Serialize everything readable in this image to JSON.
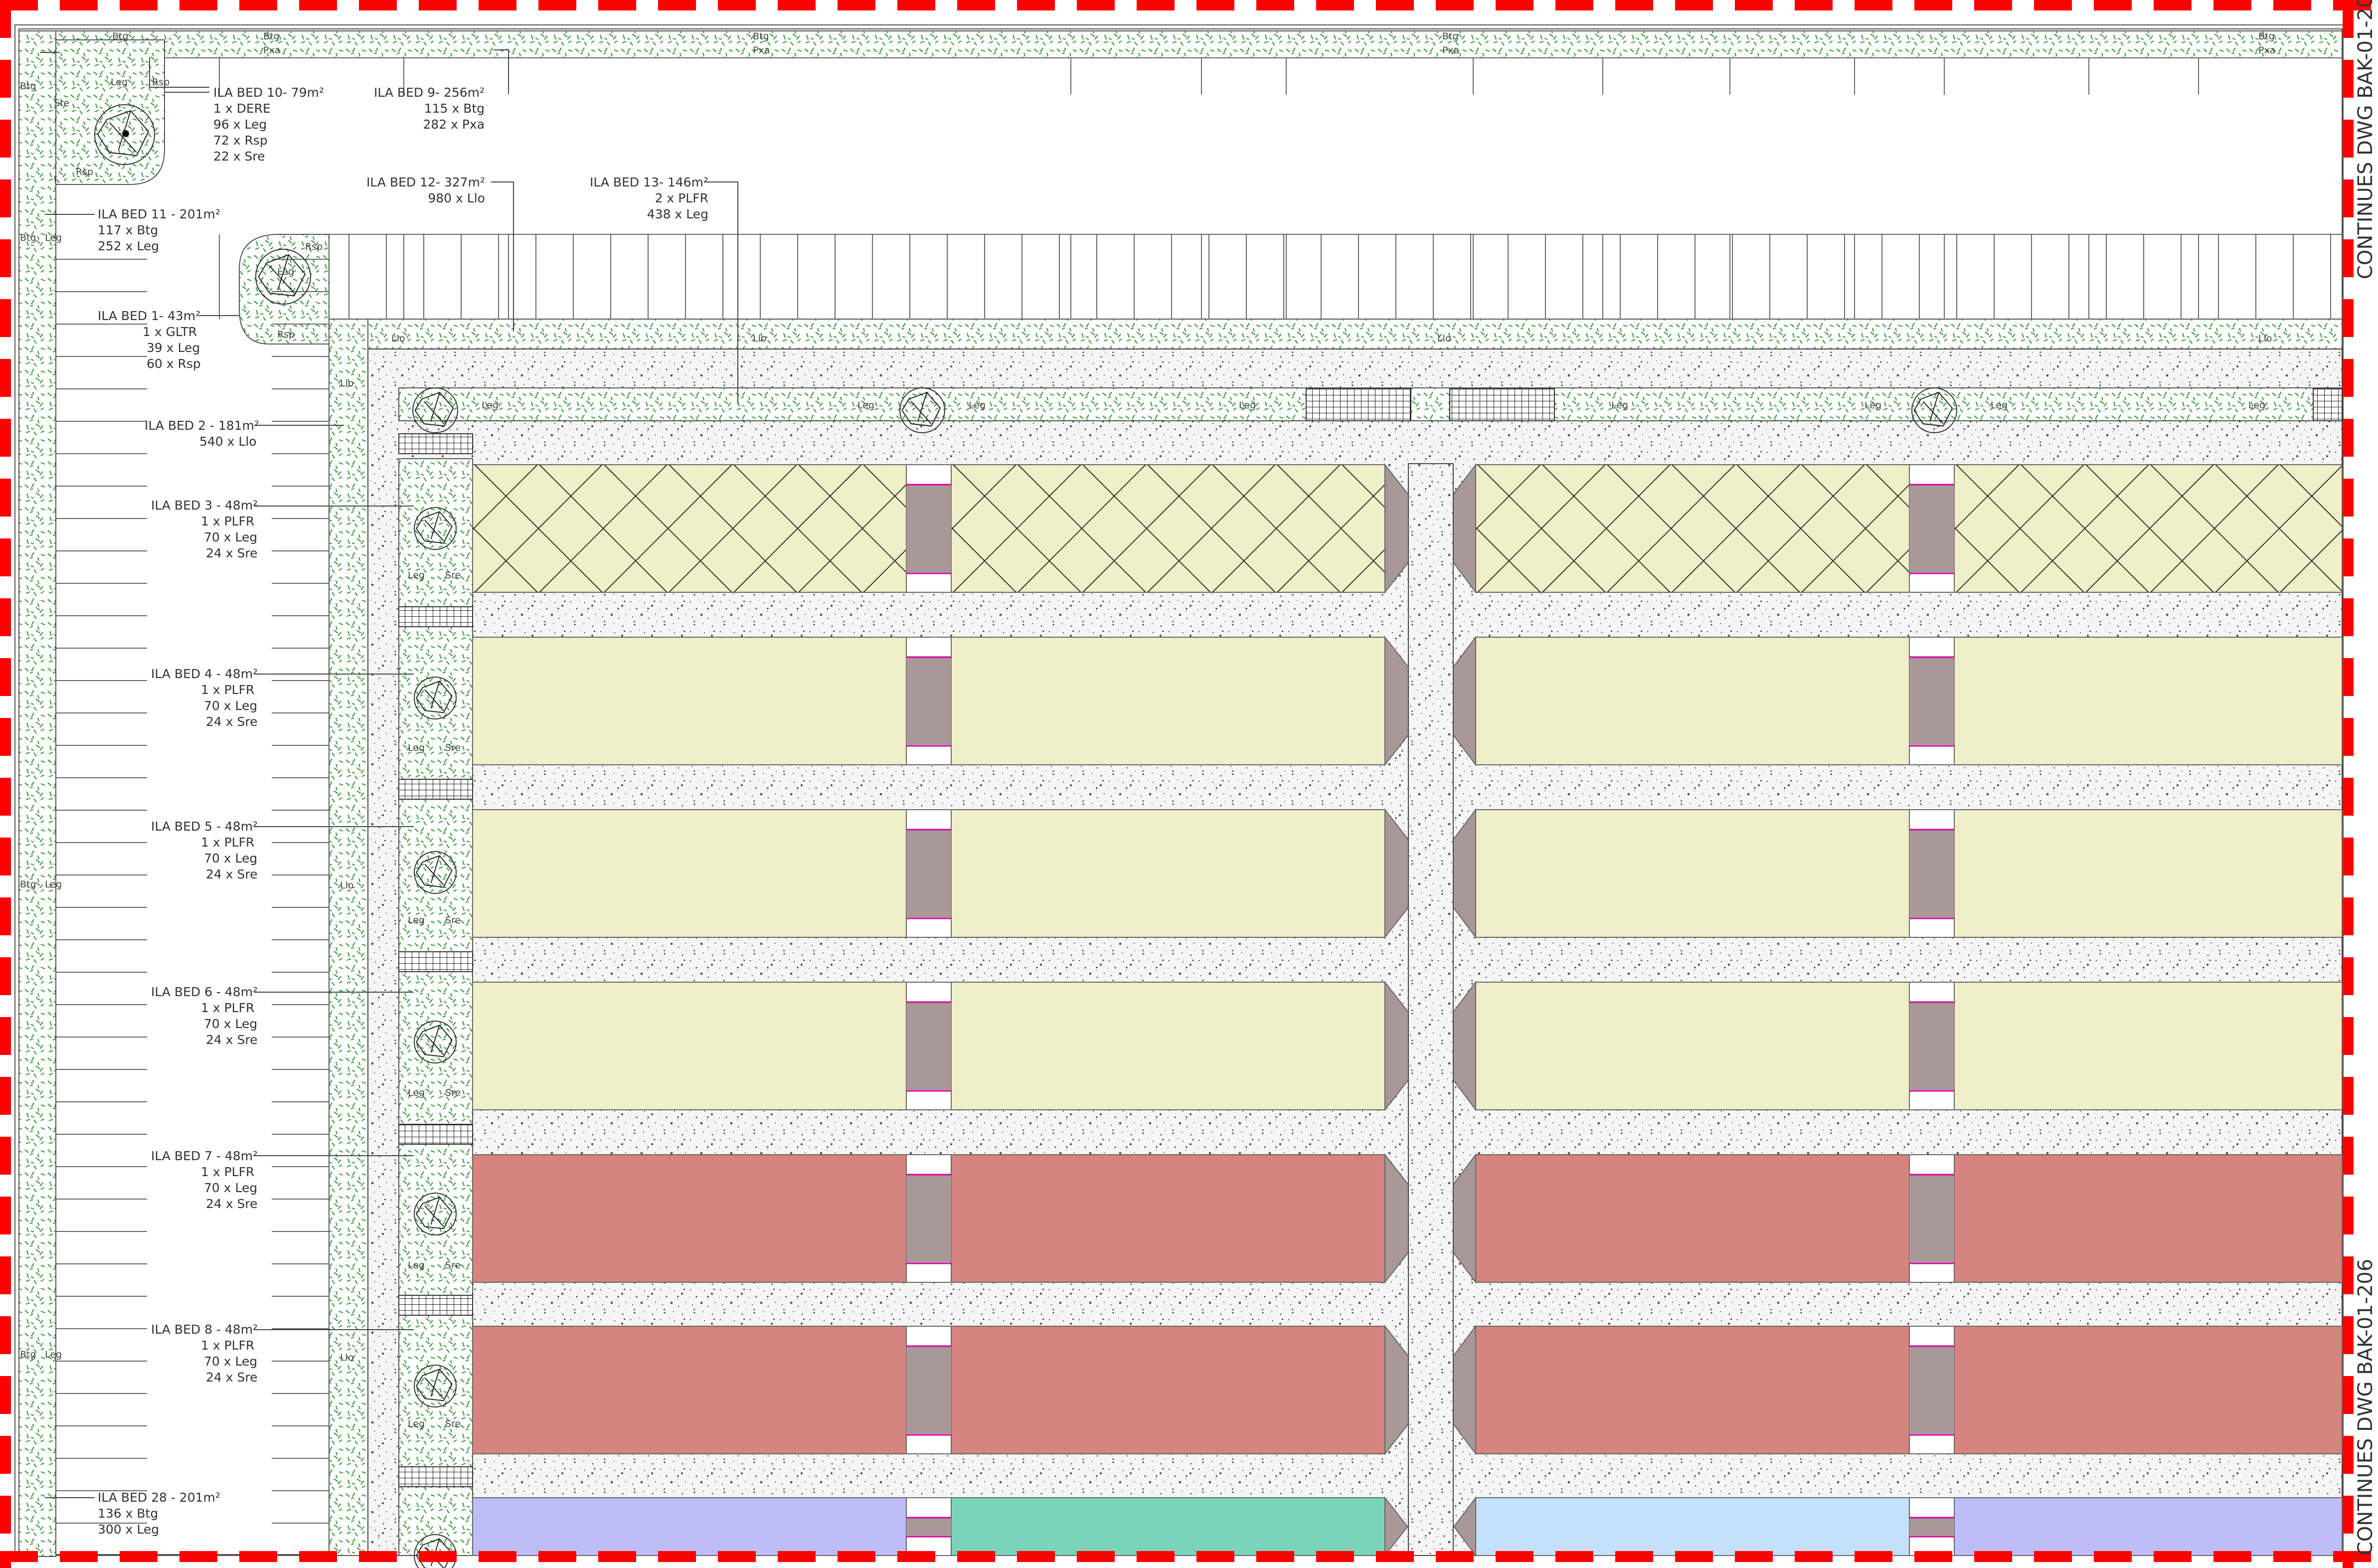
{
  "beds": [
    {
      "id": "bed10",
      "title": "ILA BED 10- 79m²",
      "rows": [
        "1 x DERE",
        "96 x Leg",
        "72 x Rsp",
        "22 x Sre"
      ]
    },
    {
      "id": "bed9",
      "title": "ILA BED 9- 256m²",
      "rows": [
        "115 x Btg",
        "282 x Pxa"
      ]
    },
    {
      "id": "bed11",
      "title": "ILA BED 11 - 201m²",
      "rows": [
        "117 x Btg",
        "252 x Leg"
      ]
    },
    {
      "id": "bed12",
      "title": "ILA BED 12- 327m²",
      "rows": [
        "980 x Llo"
      ]
    },
    {
      "id": "bed13",
      "title": "ILA BED 13- 146m²",
      "rows": [
        "2 x PLFR",
        "438 x Leg"
      ]
    },
    {
      "id": "bed1",
      "title": "ILA BED 1- 43m²",
      "rows": [
        "1 x GLTR",
        "39 x Leg",
        "60 x Rsp"
      ]
    },
    {
      "id": "bed2",
      "title": "ILA BED 2 - 181m²",
      "rows": [
        "540 x Llo"
      ]
    },
    {
      "id": "bed3",
      "title": "ILA BED 3 - 48m²",
      "rows": [
        "1 x PLFR",
        "70 x Leg",
        "24 x Sre"
      ]
    },
    {
      "id": "bed4",
      "title": "ILA BED 4 - 48m²",
      "rows": [
        "1 x PLFR",
        "70 x Leg",
        "24 x Sre"
      ]
    },
    {
      "id": "bed5",
      "title": "ILA BED 5 - 48m²",
      "rows": [
        "1 x PLFR",
        "70 x Leg",
        "24 x Sre"
      ]
    },
    {
      "id": "bed6",
      "title": "ILA BED 6 - 48m²",
      "rows": [
        "1 x PLFR",
        "70 x Leg",
        "24 x Sre"
      ]
    },
    {
      "id": "bed7",
      "title": "ILA BED 7 - 48m²",
      "rows": [
        "1 x PLFR",
        "70 x Leg",
        "24 x Sre"
      ]
    },
    {
      "id": "bed8",
      "title": "ILA BED 8 - 48m²",
      "rows": [
        "1 x PLFR",
        "70 x Leg",
        "24 x Sre"
      ]
    },
    {
      "id": "bed28",
      "title": "ILA BED 28 - 201m²",
      "rows": [
        "136 x Btg",
        "300 x Leg"
      ]
    }
  ],
  "plant_codes": {
    "btg": "Btg",
    "pxa": "Pxa",
    "leg": "Leg",
    "rsp": "Rsp",
    "sre": "Sre",
    "llo": "Llo"
  },
  "continuation_note": "CONTINUES DWG BAK-01-206",
  "colors": {
    "planting_hatch": "#3a9a3a",
    "paving": "#f4f4f4",
    "bed_yellow": "#efefc8",
    "bed_red": "#d6847e",
    "bed_purple": "#bdbdf7",
    "bed_teal": "#7ad4bb",
    "bed_lightblue": "#c5e0fa",
    "mauve_strip": "#a89898",
    "boundary_red": "#ff0000",
    "magenta_line": "#d400a0"
  }
}
